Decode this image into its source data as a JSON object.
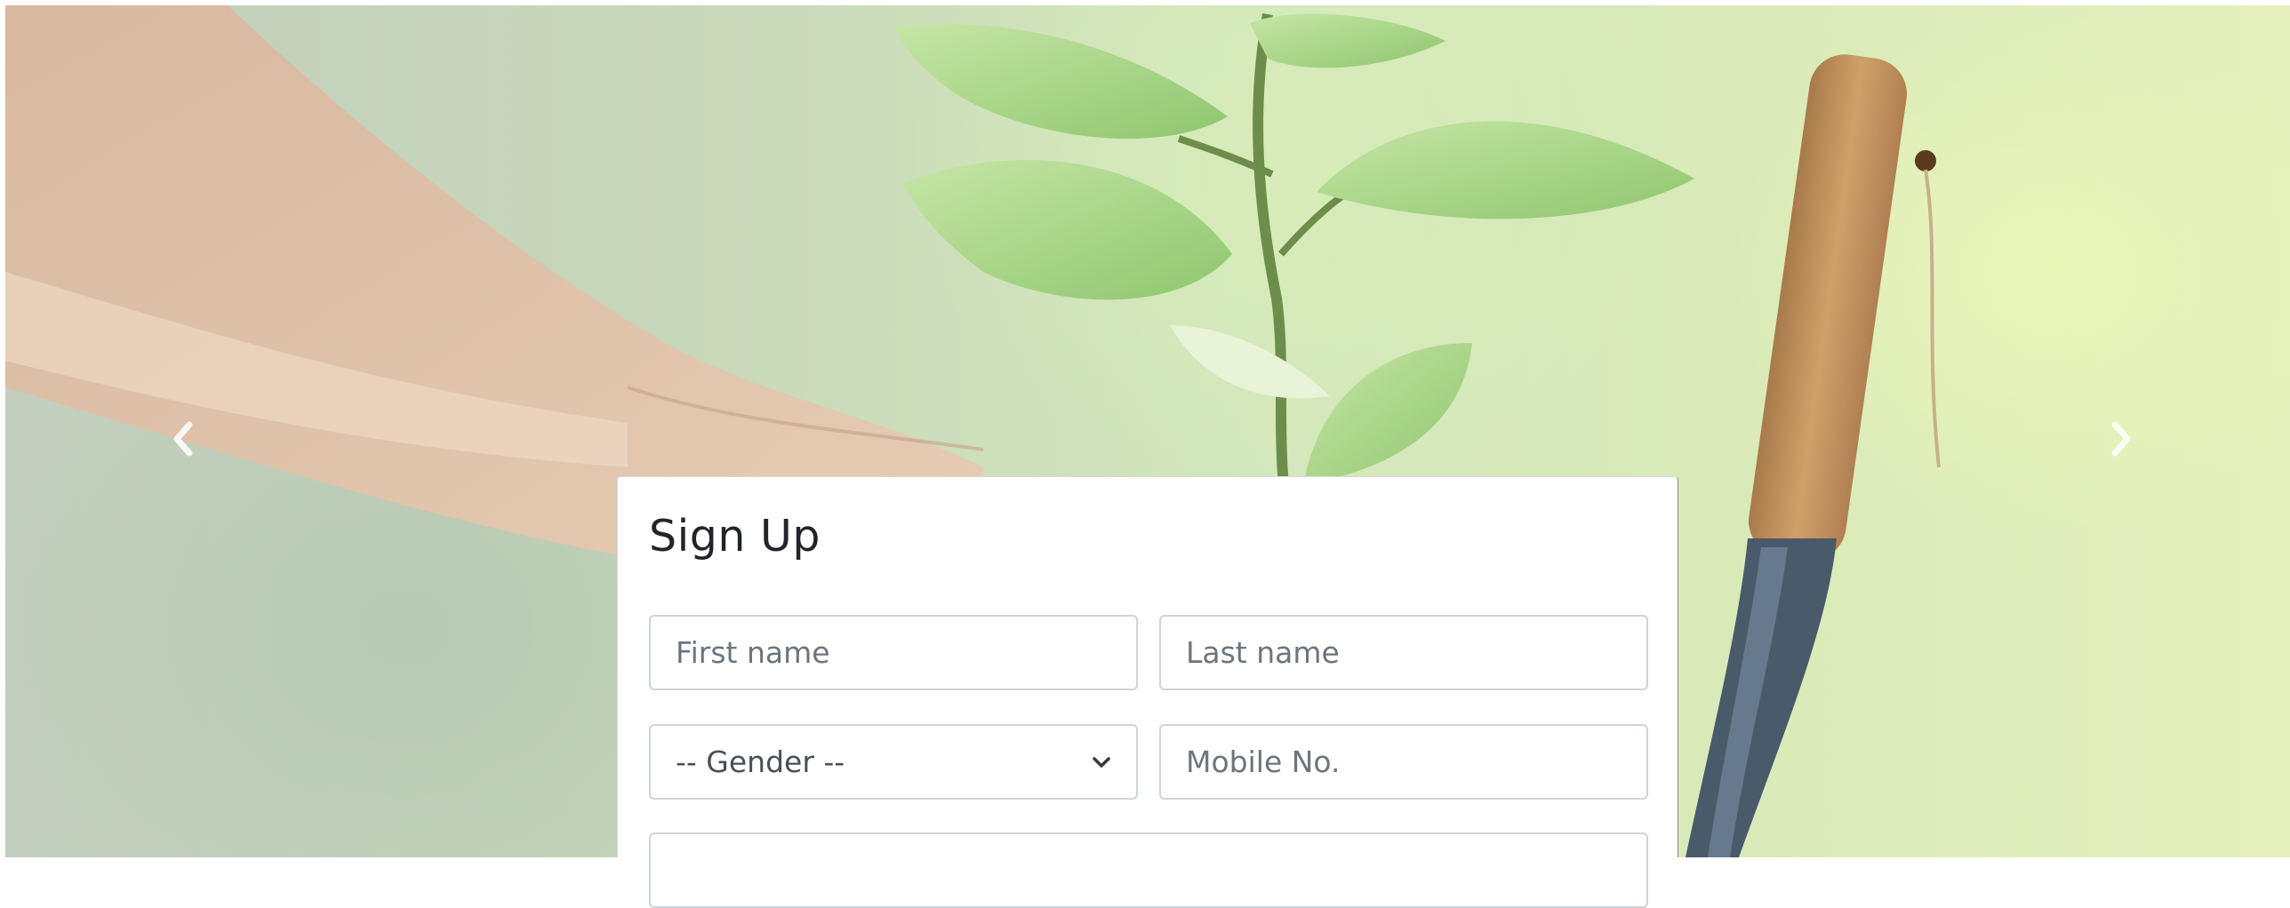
{
  "carousel": {
    "prev_icon": "chevron-left-icon",
    "next_icon": "chevron-right-icon"
  },
  "signup": {
    "title": "Sign Up",
    "first_name_placeholder": "First name",
    "last_name_placeholder": "Last name",
    "gender_selected": "-- Gender --",
    "mobile_placeholder": "Mobile No."
  },
  "colors": {
    "card_bg": "#ffffff",
    "input_border": "#ced4da",
    "placeholder": "#6c757d",
    "title": "#212529"
  }
}
